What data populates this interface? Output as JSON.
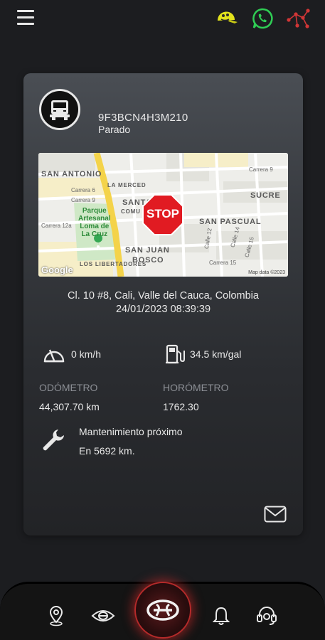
{
  "header": {
    "menu_icon": "hamburger-menu-icon",
    "right_icons": [
      "cap-icon",
      "whatsapp-icon",
      "network-icon"
    ]
  },
  "vehicle": {
    "id": "9F3BCN4H3M210",
    "status": "Parado",
    "icon": "truck-icon"
  },
  "map": {
    "labels": {
      "san_antonio": "SAN ANTONIO",
      "sucre": "SUCRE",
      "santa": "SANTA",
      "comu": "COMU",
      "san_pascual": "SAN PASCUAL",
      "san_juan": "SAN JUAN",
      "bosco": "BOSCO",
      "la_merced": "LA MERCED",
      "libertadores": "LOS LIBERTADORES"
    },
    "streets": {
      "carrera9_top": "Carrera 9",
      "carrera6": "Carrera 6",
      "carrera9": "Carrera 9",
      "carrera12a": "Carrera 12a",
      "calle12": "Calle 12",
      "calle14": "Calle 14",
      "calle15": "Calle 15",
      "carrera15": "Carrera 15"
    },
    "park": "Parque\nArtesanal\nLoma de\nLa Cruz",
    "stop_text": "STOP",
    "attribution": "Google",
    "map_data": "Map data ©2023"
  },
  "location": {
    "address": "Cl. 10 #8, Cali, Valle del Cauca, Colombia",
    "timestamp": "24/01/2023 08:39:39"
  },
  "metrics": {
    "speed": "0 km/h",
    "fuel": "34.5 km/gal",
    "odometer_label": "ODÓMETRO",
    "odometer_value": "44,307.70 km",
    "hourmeter_label": "HORÓMETRO",
    "hourmeter_value": "1762.30"
  },
  "maintenance": {
    "title": "Mantenimiento próximo",
    "value": "En 5692 km."
  },
  "colors": {
    "background": "#1c1d20",
    "accent_red": "#c62828",
    "label_gray": "#8d9096"
  },
  "bottom_nav": [
    "location-pin-icon",
    "eye-icon",
    "hino-logo-icon",
    "bell-icon",
    "headset-icon"
  ]
}
